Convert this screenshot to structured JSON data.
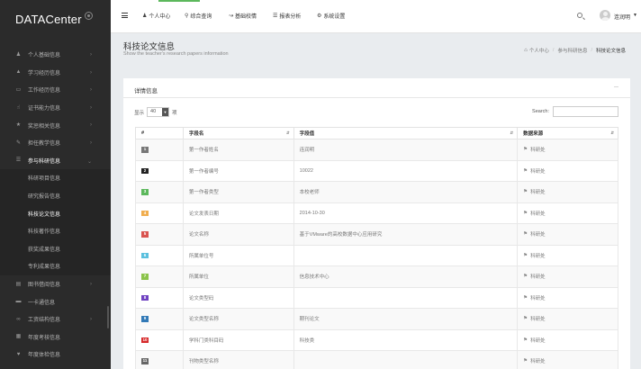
{
  "brand": {
    "title": "DATACenter"
  },
  "sidebar": {
    "items": [
      {
        "label": "个人基础信息",
        "icon": "user-icon"
      },
      {
        "label": "学习经历信息",
        "icon": "graduation-cap-icon"
      },
      {
        "label": "工作经历信息",
        "icon": "monitor-icon"
      },
      {
        "label": "证书能力信息",
        "icon": "thumbs-up-icon"
      },
      {
        "label": "奖惩相关信息",
        "icon": "trophy-icon"
      },
      {
        "label": "担任教学信息",
        "icon": "pencil-icon"
      },
      {
        "label": "参与科研信息",
        "icon": "database-icon",
        "open": true
      },
      {
        "label": "图书借阅信息",
        "icon": "book-icon"
      },
      {
        "label": "一卡通信息",
        "icon": "card-icon"
      },
      {
        "label": "工资结构信息",
        "icon": "link-icon"
      },
      {
        "label": "年度考核信息",
        "icon": "table-icon"
      },
      {
        "label": "年度体检信息",
        "icon": "heart-icon"
      }
    ],
    "subitems": [
      {
        "label": "科研项目信息"
      },
      {
        "label": "研究报告信息"
      },
      {
        "label": "科技论文信息",
        "active": true
      },
      {
        "label": "科技著作信息"
      },
      {
        "label": "获奖成果信息"
      },
      {
        "label": "专利成果信息"
      }
    ]
  },
  "topbar": {
    "nav": [
      {
        "label": "个人中心",
        "icon": "user-icon"
      },
      {
        "label": "综合查询",
        "icon": "search-icon"
      },
      {
        "label": "基础校情",
        "icon": "chart-icon"
      },
      {
        "label": "报表分析",
        "icon": "list-icon"
      },
      {
        "label": "系统设置",
        "icon": "gear-icon"
      }
    ],
    "username": "连润明"
  },
  "page": {
    "title": "科技论文信息",
    "subtitle": "Show the teacher's research papers information"
  },
  "breadcrumb": {
    "home": "个人中心",
    "parent": "参与科研信息",
    "current": "科技论文信息"
  },
  "panel": {
    "title": "详情信息",
    "show_prefix": "显示",
    "show_value": "40",
    "show_suffix": "项",
    "search_label": "Search:",
    "columns": [
      "#",
      "字段名",
      "字段值",
      "数据来源"
    ],
    "rows": [
      {
        "num": "1",
        "color": "#777777",
        "name": "第一作者姓名",
        "value": "连润明",
        "source": "科研处"
      },
      {
        "num": "2",
        "color": "#222222",
        "name": "第一作者编号",
        "value": "10022",
        "source": "科研处"
      },
      {
        "num": "3",
        "color": "#5cb85c",
        "name": "第一作者类型",
        "value": "本校老师",
        "source": "科研处"
      },
      {
        "num": "4",
        "color": "#f0ad4e",
        "name": "论文发表日期",
        "value": "2014-10-30",
        "source": "科研处"
      },
      {
        "num": "5",
        "color": "#d9534f",
        "name": "论文名称",
        "value": "基于VMware的高校数据中心应用研究",
        "source": "科研处"
      },
      {
        "num": "6",
        "color": "#5bc0de",
        "name": "所属单位号",
        "value": "",
        "source": "科研处"
      },
      {
        "num": "7",
        "color": "#8bc34a",
        "name": "所属单位",
        "value": "信息技术中心",
        "source": "科研处"
      },
      {
        "num": "8",
        "color": "#6f42c1",
        "name": "论文类型码",
        "value": "",
        "source": "科研处"
      },
      {
        "num": "9",
        "color": "#337ab7",
        "name": "论文类型名称",
        "value": "期刊论文",
        "source": "科研处"
      },
      {
        "num": "10",
        "color": "#d62728",
        "name": "学科门类科目码",
        "value": "科技类",
        "source": "科研处"
      },
      {
        "num": "11",
        "color": "#666666",
        "name": "刊物类型名称",
        "value": "",
        "source": "科研处"
      }
    ]
  }
}
